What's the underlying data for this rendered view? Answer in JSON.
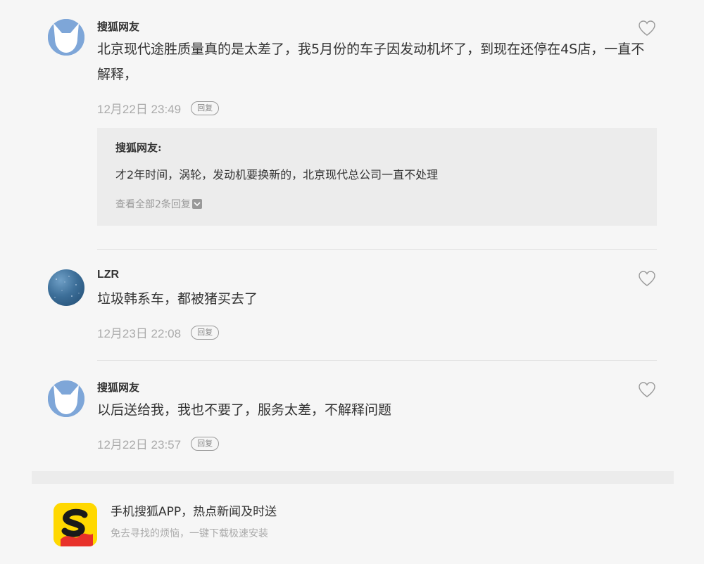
{
  "comments": [
    {
      "author": "搜狐网友",
      "text": "北京现代途胜质量真的是太差了，我5月份的车子因发动机坏了，到现在还停在4S店，一直不解释，",
      "time": "12月22日 23:49",
      "reply_label": "回复",
      "avatar": "sohu-fox-avatar",
      "quote": {
        "author": "搜狐网友:",
        "text": "才2年时间，涡轮，发动机要换新的，北京现代总公司一直不处理",
        "more_label": "查看全部2条回复"
      }
    },
    {
      "author": "LZR",
      "text": "垃圾韩系车，都被猪买去了",
      "time": "12月23日 22:08",
      "reply_label": "回复",
      "avatar": "starry-sky-avatar"
    },
    {
      "author": "搜狐网友",
      "text": "以后送给我，我也不要了，服务太差，不解释问题",
      "time": "12月22日 23:57",
      "reply_label": "回复",
      "avatar": "sohu-fox-avatar"
    }
  ],
  "app_promo": {
    "title": "手机搜狐APP，热点新闻及时送",
    "subtitle": "免去寻找的烦恼，一键下载极速安装",
    "icon": "sohu-app-icon"
  },
  "icons": {
    "like": "heart-outline-icon",
    "expand": "chevron-down-icon"
  },
  "colors": {
    "background": "#f6f6f6",
    "quote_bg": "#ececec",
    "muted_text": "#aaaaaa",
    "avatar_blue": "#7ea6d8",
    "app_yellow": "#ffd800",
    "app_red": "#e8312a"
  }
}
